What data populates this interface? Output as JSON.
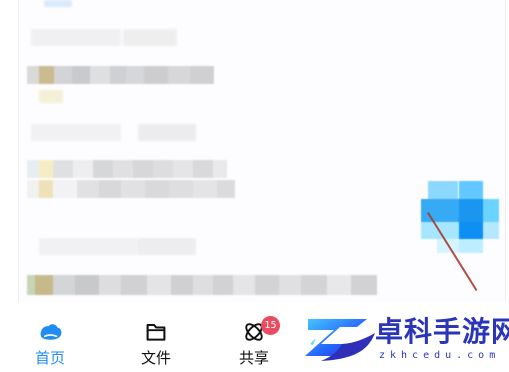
{
  "tabs": [
    {
      "label": "首页",
      "icon": "cloud-home-icon",
      "active": true
    },
    {
      "label": "文件",
      "icon": "folder-icon",
      "active": false
    },
    {
      "label": "共享",
      "icon": "share-icon",
      "active": false,
      "badge": "15"
    }
  ],
  "colors": {
    "accent": "#1f8df2",
    "badge": "#ea4b5f",
    "watermark": "#2a35b8"
  },
  "watermark": {
    "title": "卓科手游网",
    "subtitle": "zkhcedu.com"
  }
}
